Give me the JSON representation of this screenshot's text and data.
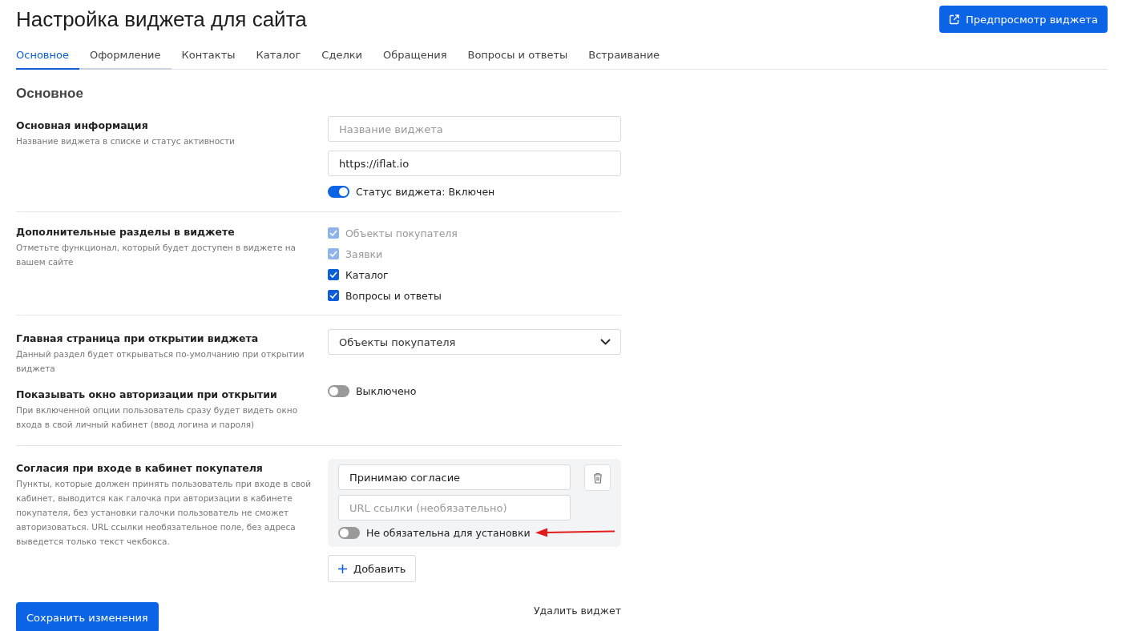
{
  "page": {
    "title": "Настройка виджета для сайта",
    "preview_button": "Предпросмотр виджета"
  },
  "tabs": [
    {
      "label": "Основное",
      "selected": true,
      "hovered": false
    },
    {
      "label": "Оформление",
      "selected": false,
      "hovered": true
    },
    {
      "label": "Контакты",
      "selected": false,
      "hovered": false
    },
    {
      "label": "Каталог",
      "selected": false,
      "hovered": false
    },
    {
      "label": "Сделки",
      "selected": false,
      "hovered": false
    },
    {
      "label": "Обращения",
      "selected": false,
      "hovered": false
    },
    {
      "label": "Вопросы и ответы",
      "selected": false,
      "hovered": false
    },
    {
      "label": "Встраивание",
      "selected": false,
      "hovered": false
    }
  ],
  "section_title": "Основное",
  "basic_info": {
    "title": "Основная информация",
    "description": "Название виджета в списке и статус активности",
    "name_field": {
      "placeholder": "Название виджета"
    },
    "url_field": {
      "value": "https://iflat.io"
    },
    "status": {
      "label": "Статус виджета: Включен",
      "on": true
    }
  },
  "extra_sections": {
    "title": "Дополнительные разделы в виджете",
    "description": "Отметьте функционал, который будет доступен в виджете на вашем сайте",
    "options": [
      {
        "label": "Объекты покупателя",
        "checked": true,
        "disabled": true
      },
      {
        "label": "Заявки",
        "checked": true,
        "disabled": true
      },
      {
        "label": "Каталог",
        "checked": true,
        "disabled": false
      },
      {
        "label": "Вопросы и ответы",
        "checked": true,
        "disabled": false
      }
    ]
  },
  "home_page": {
    "title": "Главная страница при открытии виджета",
    "description": "Данный раздел будет открываться по-умолчанию при открытии виджета",
    "select": {
      "value": "Объекты покупателя"
    }
  },
  "auth_window": {
    "title": "Показывать окно авторизации при открытии",
    "description": "При включенной опции пользователь сразу будет видеть окно входа в свой личный кабинет (ввод логина и пароля)",
    "toggle": {
      "label": "Выключено",
      "on": false
    }
  },
  "consents": {
    "title": "Согласия при входе в кабинет покупателя",
    "description": "Пункты, которые должен принять пользователь при входе в свой кабинет, выводится как галочка при авторизации в кабинете покупателя, без установки галочки пользователь не сможет авторизоваться. URL ссылки необязательное поле, без адреса выведется только текст чекбокса.",
    "items": [
      {
        "text": "Принимаю согласие",
        "url_placeholder": "URL ссылки (необязательно)",
        "toggle_label": "Не обязательна для установки",
        "on": false
      }
    ],
    "add_button": "Добавить"
  },
  "footer": {
    "save_button": "Сохранить изменения",
    "delete_link": "Удалить виджет"
  }
}
